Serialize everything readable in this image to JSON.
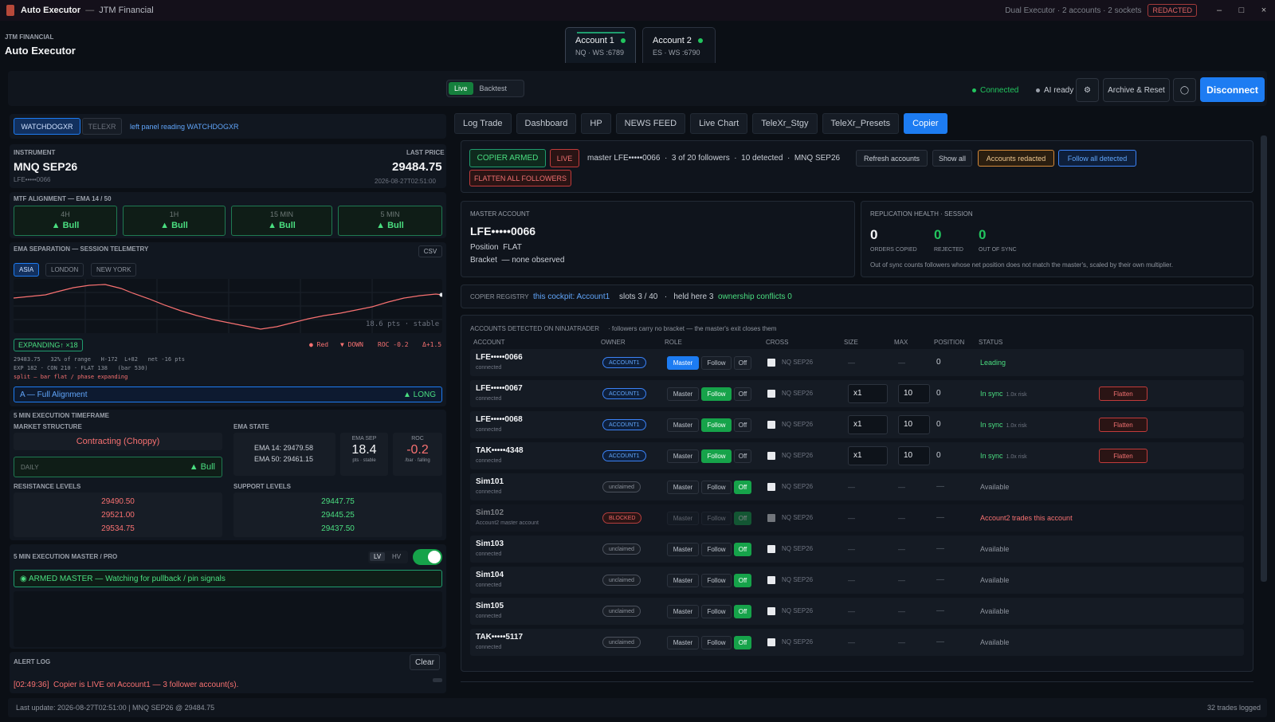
{
  "titlebar": {
    "title": "Auto Executor",
    "sep": "—",
    "company": "JTM Financial",
    "status": "Dual Executor · 2 accounts · 2 sockets",
    "badge": "REDACTED",
    "min": "–",
    "max": "□",
    "close": "×"
  },
  "brand": {
    "small": "JTM FINANCIAL",
    "big": "Auto Executor"
  },
  "account_tabs": [
    {
      "name": "Account 1",
      "sub": "NQ · WS :6789"
    },
    {
      "name": "Account 2",
      "sub": "ES · WS :6790"
    }
  ],
  "mode": {
    "live": "Live",
    "backtest": "Backtest"
  },
  "status": {
    "connected": "Connected",
    "ai": "AI ready",
    "archive": "Archive & Reset",
    "disconnect": "Disconnect"
  },
  "left": {
    "tab_watch": "WATCHDOGXR",
    "tab_telexr": "TELEXR",
    "reading": "left panel reading WATCHDOGXR",
    "instrument_lbl": "INSTRUMENT",
    "instrument": "MNQ SEP26",
    "instrument_acct": "LFE•••••0066",
    "last_price_lbl": "LAST PRICE",
    "last_price": "29484.75",
    "last_time": "2026-08-27T02:51:00",
    "mtf_lbl": "MTF ALIGNMENT — EMA 14 / 50",
    "mtf": [
      {
        "tf": "4H",
        "v": "▲ Bull"
      },
      {
        "tf": "1H",
        "v": "▲ Bull"
      },
      {
        "tf": "15 MIN",
        "v": "▲ Bull"
      },
      {
        "tf": "5 MIN",
        "v": "▲ Bull"
      }
    ],
    "ema_sep_lbl": "EMA SEPARATION — SESSION TELEMETRY",
    "csv": "CSV",
    "sessions": [
      "ASIA",
      "LONDON",
      "NEW YORK"
    ],
    "chart_note": "18.6 pts · stable",
    "expanding": "EXPANDING↑ ×18",
    "red": "● Red",
    "down": "▼ DOWN",
    "roc": "ROC -0.2",
    "delta": "Δ+1.5",
    "stat1": "29483.75   32% of range   H-172  L+82   net -16 pts",
    "stat2": "EXP 182 · CON 210 · FLAT 138   (bar 530)",
    "stat3": "split — bar flat / phase expanding",
    "align": "A — Full Alignment",
    "long": "▲ LONG",
    "exec_lbl": "5 MIN EXECUTION TIMEFRAME",
    "ms_lbl": "MARKET STRUCTURE",
    "ms": "Contracting (Choppy)",
    "daily": "DAILY",
    "daily_v": "▲ Bull",
    "ema_state_lbl": "EMA STATE",
    "ema14": "EMA 14:  29479.58",
    "ema50": "EMA 50:  29461.15",
    "emasep_lbl": "EMA SEP",
    "emasep": "18.4",
    "emasep_sub": "pts · stable",
    "roc_lbl": "ROC",
    "roc_v": "-0.2",
    "roc_sub": "/bar · falling",
    "res_lbl": "RESISTANCE LEVELS",
    "res": [
      "29490.50",
      "29521.00",
      "29534.75"
    ],
    "sup_lbl": "SUPPORT LEVELS",
    "sup": [
      "29447.75",
      "29445.25",
      "29437.50"
    ],
    "master_lbl": "5 MIN EXECUTION MASTER / PRO",
    "lv": "LV",
    "hv": "HV",
    "armed": "◉ ARMED MASTER — Watching for pullback / pin signals",
    "alert_lbl": "ALERT LOG",
    "clear": "Clear",
    "alert": "[02:49:36]  Copier is LIVE on Account1 — 3 follower account(s)."
  },
  "tabs": [
    "Log Trade",
    "Dashboard",
    "HP",
    "NEWS FEED",
    "Live Chart",
    "TeleXr_Stgy",
    "TeleXr_Presets",
    "Copier"
  ],
  "copier": {
    "armed": "COPIER ARMED",
    "live": "LIVE",
    "summary": "master LFE•••••0066  ·  3 of 20 followers  ·  10 detected  ·  MNQ SEP26",
    "refresh": "Refresh accounts",
    "show_all": "Show all",
    "redacted": "Accounts redacted",
    "follow_all": "Follow all detected",
    "flatten_all": "FLATTEN ALL FOLLOWERS",
    "master_lbl": "MASTER ACCOUNT",
    "master": "LFE•••••0066",
    "position": "Position  FLAT",
    "bracket": "Bracket  — none observed",
    "health_lbl": "REPLICATION HEALTH · SESSION",
    "health": [
      {
        "v": "0",
        "l": "ORDERS COPIED"
      },
      {
        "v": "0",
        "l": "REJECTED"
      },
      {
        "v": "0",
        "l": "OUT OF SYNC"
      }
    ],
    "health_note": "Out of sync counts followers whose net position does not match the master's, scaled by their own multiplier.",
    "registry_lbl": "COPIER REGISTRY",
    "registry_ck": "this cockpit: Account1",
    "registry_slots": "slots 3 / 40   ·   held here 3",
    "registry_conf": "ownership conflicts 0",
    "detected_lbl": "ACCOUNTS DETECTED ON NINJATRADER",
    "detected_note": "·  followers carry no bracket — the master's exit closes them",
    "cols": [
      "ACCOUNT",
      "OWNER",
      "ROLE",
      "CROSS",
      "SIZE",
      "MAX",
      "POSITION",
      "STATUS"
    ],
    "role_btns": [
      "Master",
      "Follow",
      "Off"
    ],
    "rows": [
      {
        "acc": "LFE•••••0066",
        "sub": "connected",
        "owner": "ACCOUNT1",
        "cross": "NQ SEP26",
        "size": "—",
        "max": "—",
        "pos": "0",
        "status": "Leading",
        "risk": "",
        "flatten": ""
      },
      {
        "acc": "LFE•••••0067",
        "sub": "connected",
        "owner": "ACCOUNT1",
        "cross": "NQ SEP26",
        "size": "x1",
        "max": "10",
        "pos": "0",
        "status": "In sync",
        "risk": "1.0x risk",
        "flatten": "Flatten"
      },
      {
        "acc": "LFE•••••0068",
        "sub": "connected",
        "owner": "ACCOUNT1",
        "cross": "NQ SEP26",
        "size": "x1",
        "max": "10",
        "pos": "0",
        "status": "In sync",
        "risk": "1.0x risk",
        "flatten": "Flatten"
      },
      {
        "acc": "TAK•••••4348",
        "sub": "connected",
        "owner": "ACCOUNT1",
        "cross": "NQ SEP26",
        "size": "x1",
        "max": "10",
        "pos": "0",
        "status": "In sync",
        "risk": "1.0x risk",
        "flatten": "Flatten"
      },
      {
        "acc": "Sim101",
        "sub": "connected",
        "owner": "unclaimed",
        "cross": "NQ SEP26",
        "size": "—",
        "max": "—",
        "pos": "—",
        "status": "Available",
        "risk": "",
        "flatten": ""
      },
      {
        "acc": "Sim102",
        "sub": "Account2 master account",
        "owner": "BLOCKED",
        "cross": "NQ SEP26",
        "size": "—",
        "max": "—",
        "pos": "—",
        "status": "Account2 trades this account",
        "risk": "",
        "flatten": ""
      },
      {
        "acc": "Sim103",
        "sub": "connected",
        "owner": "unclaimed",
        "cross": "NQ SEP26",
        "size": "—",
        "max": "—",
        "pos": "—",
        "status": "Available",
        "risk": "",
        "flatten": ""
      },
      {
        "acc": "Sim104",
        "sub": "connected",
        "owner": "unclaimed",
        "cross": "NQ SEP26",
        "size": "—",
        "max": "—",
        "pos": "—",
        "status": "Available",
        "risk": "",
        "flatten": ""
      },
      {
        "acc": "Sim105",
        "sub": "connected",
        "owner": "unclaimed",
        "cross": "NQ SEP26",
        "size": "—",
        "max": "—",
        "pos": "—",
        "status": "Available",
        "risk": "",
        "flatten": ""
      },
      {
        "acc": "TAK•••••5117",
        "sub": "connected",
        "owner": "unclaimed",
        "cross": "NQ SEP26",
        "size": "—",
        "max": "—",
        "pos": "—",
        "status": "Available",
        "risk": "",
        "flatten": ""
      }
    ]
  },
  "footer": {
    "left": "Last update: 2026-08-27T02:51:00 | MNQ SEP26 @ 29484.75",
    "right": "32 trades logged"
  },
  "colors": {
    "accent": "#1d7cf2",
    "green": "#22c55e",
    "red": "#ef4444",
    "bg": "#0b0f15"
  }
}
